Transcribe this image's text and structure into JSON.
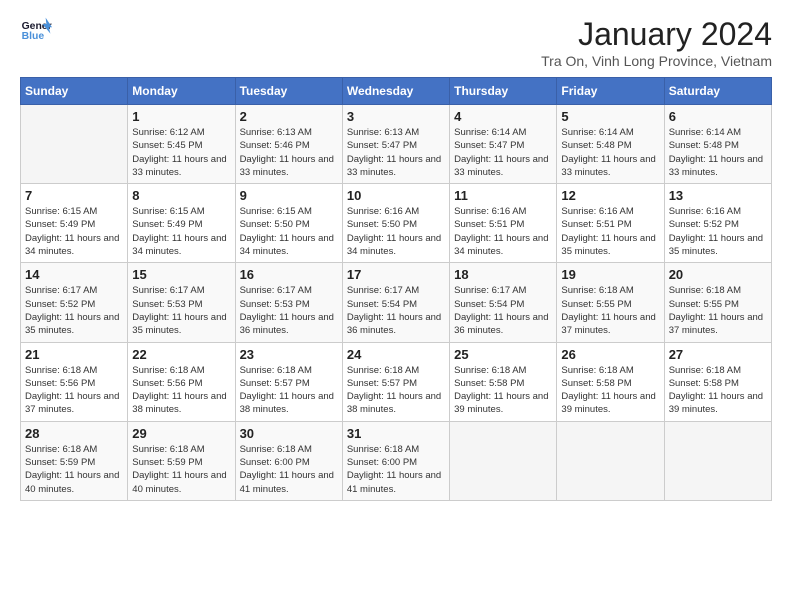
{
  "header": {
    "logo_text_general": "General",
    "logo_text_blue": "Blue",
    "month": "January 2024",
    "location": "Tra On, Vinh Long Province, Vietnam"
  },
  "days_of_week": [
    "Sunday",
    "Monday",
    "Tuesday",
    "Wednesday",
    "Thursday",
    "Friday",
    "Saturday"
  ],
  "weeks": [
    [
      {
        "num": "",
        "sunrise": "",
        "sunset": "",
        "daylight": ""
      },
      {
        "num": "1",
        "sunrise": "6:12 AM",
        "sunset": "5:45 PM",
        "daylight": "11 hours and 33 minutes."
      },
      {
        "num": "2",
        "sunrise": "6:13 AM",
        "sunset": "5:46 PM",
        "daylight": "11 hours and 33 minutes."
      },
      {
        "num": "3",
        "sunrise": "6:13 AM",
        "sunset": "5:47 PM",
        "daylight": "11 hours and 33 minutes."
      },
      {
        "num": "4",
        "sunrise": "6:14 AM",
        "sunset": "5:47 PM",
        "daylight": "11 hours and 33 minutes."
      },
      {
        "num": "5",
        "sunrise": "6:14 AM",
        "sunset": "5:48 PM",
        "daylight": "11 hours and 33 minutes."
      },
      {
        "num": "6",
        "sunrise": "6:14 AM",
        "sunset": "5:48 PM",
        "daylight": "11 hours and 33 minutes."
      }
    ],
    [
      {
        "num": "7",
        "sunrise": "6:15 AM",
        "sunset": "5:49 PM",
        "daylight": "11 hours and 34 minutes."
      },
      {
        "num": "8",
        "sunrise": "6:15 AM",
        "sunset": "5:49 PM",
        "daylight": "11 hours and 34 minutes."
      },
      {
        "num": "9",
        "sunrise": "6:15 AM",
        "sunset": "5:50 PM",
        "daylight": "11 hours and 34 minutes."
      },
      {
        "num": "10",
        "sunrise": "6:16 AM",
        "sunset": "5:50 PM",
        "daylight": "11 hours and 34 minutes."
      },
      {
        "num": "11",
        "sunrise": "6:16 AM",
        "sunset": "5:51 PM",
        "daylight": "11 hours and 34 minutes."
      },
      {
        "num": "12",
        "sunrise": "6:16 AM",
        "sunset": "5:51 PM",
        "daylight": "11 hours and 35 minutes."
      },
      {
        "num": "13",
        "sunrise": "6:16 AM",
        "sunset": "5:52 PM",
        "daylight": "11 hours and 35 minutes."
      }
    ],
    [
      {
        "num": "14",
        "sunrise": "6:17 AM",
        "sunset": "5:52 PM",
        "daylight": "11 hours and 35 minutes."
      },
      {
        "num": "15",
        "sunrise": "6:17 AM",
        "sunset": "5:53 PM",
        "daylight": "11 hours and 35 minutes."
      },
      {
        "num": "16",
        "sunrise": "6:17 AM",
        "sunset": "5:53 PM",
        "daylight": "11 hours and 36 minutes."
      },
      {
        "num": "17",
        "sunrise": "6:17 AM",
        "sunset": "5:54 PM",
        "daylight": "11 hours and 36 minutes."
      },
      {
        "num": "18",
        "sunrise": "6:17 AM",
        "sunset": "5:54 PM",
        "daylight": "11 hours and 36 minutes."
      },
      {
        "num": "19",
        "sunrise": "6:18 AM",
        "sunset": "5:55 PM",
        "daylight": "11 hours and 37 minutes."
      },
      {
        "num": "20",
        "sunrise": "6:18 AM",
        "sunset": "5:55 PM",
        "daylight": "11 hours and 37 minutes."
      }
    ],
    [
      {
        "num": "21",
        "sunrise": "6:18 AM",
        "sunset": "5:56 PM",
        "daylight": "11 hours and 37 minutes."
      },
      {
        "num": "22",
        "sunrise": "6:18 AM",
        "sunset": "5:56 PM",
        "daylight": "11 hours and 38 minutes."
      },
      {
        "num": "23",
        "sunrise": "6:18 AM",
        "sunset": "5:57 PM",
        "daylight": "11 hours and 38 minutes."
      },
      {
        "num": "24",
        "sunrise": "6:18 AM",
        "sunset": "5:57 PM",
        "daylight": "11 hours and 38 minutes."
      },
      {
        "num": "25",
        "sunrise": "6:18 AM",
        "sunset": "5:58 PM",
        "daylight": "11 hours and 39 minutes."
      },
      {
        "num": "26",
        "sunrise": "6:18 AM",
        "sunset": "5:58 PM",
        "daylight": "11 hours and 39 minutes."
      },
      {
        "num": "27",
        "sunrise": "6:18 AM",
        "sunset": "5:58 PM",
        "daylight": "11 hours and 39 minutes."
      }
    ],
    [
      {
        "num": "28",
        "sunrise": "6:18 AM",
        "sunset": "5:59 PM",
        "daylight": "11 hours and 40 minutes."
      },
      {
        "num": "29",
        "sunrise": "6:18 AM",
        "sunset": "5:59 PM",
        "daylight": "11 hours and 40 minutes."
      },
      {
        "num": "30",
        "sunrise": "6:18 AM",
        "sunset": "6:00 PM",
        "daylight": "11 hours and 41 minutes."
      },
      {
        "num": "31",
        "sunrise": "6:18 AM",
        "sunset": "6:00 PM",
        "daylight": "11 hours and 41 minutes."
      },
      {
        "num": "",
        "sunrise": "",
        "sunset": "",
        "daylight": ""
      },
      {
        "num": "",
        "sunrise": "",
        "sunset": "",
        "daylight": ""
      },
      {
        "num": "",
        "sunrise": "",
        "sunset": "",
        "daylight": ""
      }
    ]
  ]
}
